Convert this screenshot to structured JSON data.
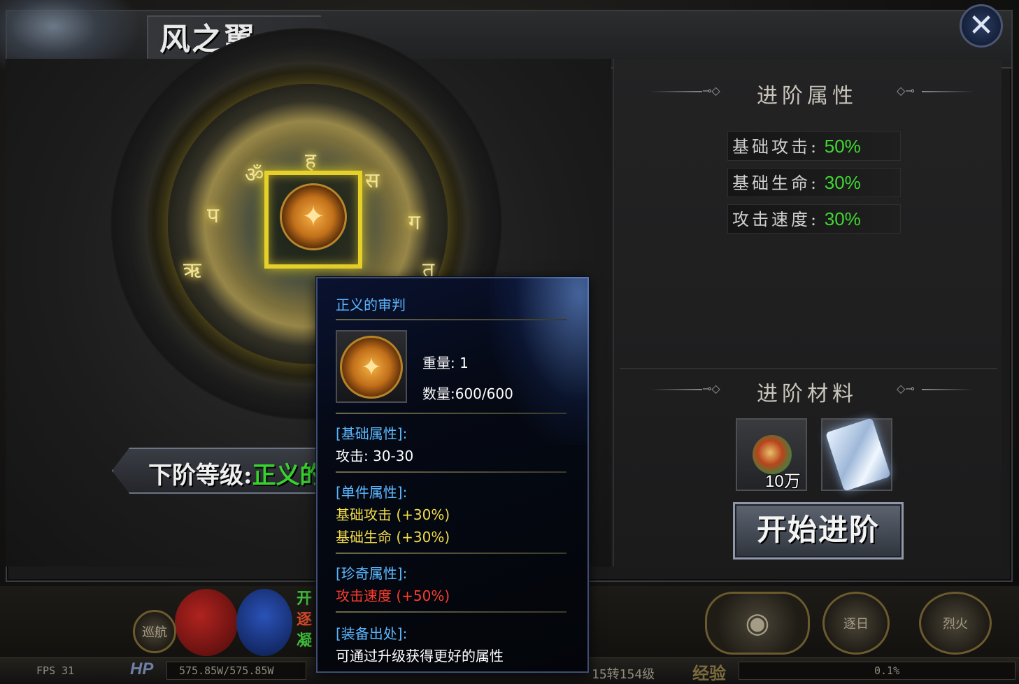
{
  "window": {
    "title": "风之翼",
    "close_icon": "close-x-icon"
  },
  "core": {
    "icon": "golden-wings-emblem"
  },
  "next_level": {
    "label": "下阶等级:",
    "value": "正义的"
  },
  "attributes": {
    "header": "进阶属性",
    "items": [
      {
        "key": "基础攻击:",
        "value": "50%"
      },
      {
        "key": "基础生命:",
        "value": "30%"
      },
      {
        "key": "攻击速度:",
        "value": "30%"
      }
    ]
  },
  "materials": {
    "header": "进阶材料",
    "items": [
      {
        "icon": "jade-orb-icon",
        "count": "10万"
      },
      {
        "icon": "scroll-icon",
        "count": ""
      }
    ],
    "advance_button": "开始进阶"
  },
  "tooltip": {
    "name": "正义的审判",
    "weight": "重量: 1",
    "quantity": "数量:600/600",
    "base_header": "[基础属性]:",
    "base_attack": "攻击: 30-30",
    "piece_header": "[单件属性]:",
    "piece_stats": [
      "基础攻击 (+30%)",
      "基础生命 (+30%)"
    ],
    "rare_header": "[珍奇属性]:",
    "rare_stats": [
      "攻击速度 (+50%)"
    ],
    "source_header": "[装备出处]:",
    "source_text": "可通过升级获得更好的属性"
  },
  "hud": {
    "fps": "FPS 31",
    "hp_label": "HP",
    "hp_value": "575.85W/575.85W",
    "level_text": "15转154级",
    "exp_label": "经验",
    "exp_value": "0.1%",
    "cruise_button": "巡航",
    "side_text": [
      "开",
      "逐",
      "凝"
    ],
    "skill_buttons": [
      "逐日",
      "烈火"
    ]
  },
  "colors": {
    "accent_green": "#3fd932",
    "tooltip_blue": "#5cb8ff",
    "tooltip_yellow": "#f3dc49",
    "tooltip_red": "#ff3b2b",
    "highlight_gold": "#e6d02a"
  }
}
